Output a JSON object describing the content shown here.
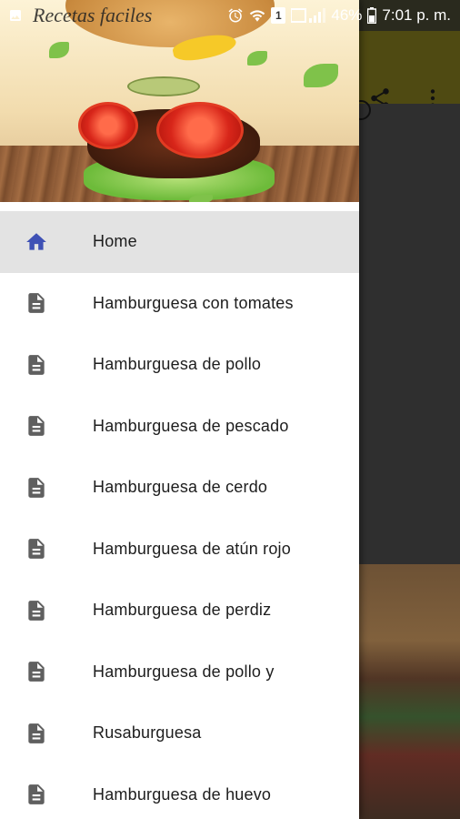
{
  "status_bar": {
    "app_title": "Recetas faciles",
    "sim_badge": "1",
    "battery_percent": "46%",
    "time": "7:01 p. m.",
    "icons": [
      "gallery-icon",
      "alarm-icon",
      "wifi-icon",
      "sim-icon",
      "signal-icon",
      "battery-icon"
    ]
  },
  "app": {
    "toolbar_color": "#4f4a12",
    "actions": [
      "share-icon",
      "overflow-menu-icon"
    ]
  },
  "drawer": {
    "header_image": "burger-photo",
    "selected_color": "#e3e3e3",
    "home_icon_color": "#3f51b5",
    "doc_icon_color": "#5f5f5f",
    "items": [
      {
        "label": "Home",
        "icon": "home-icon",
        "selected": true
      },
      {
        "label": "Hamburguesa con tomates",
        "icon": "document-icon",
        "selected": false
      },
      {
        "label": "Hamburguesa de pollo",
        "icon": "document-icon",
        "selected": false
      },
      {
        "label": "Hamburguesa de pescado",
        "icon": "document-icon",
        "selected": false
      },
      {
        "label": "Hamburguesa de cerdo",
        "icon": "document-icon",
        "selected": false
      },
      {
        "label": "Hamburguesa de atún rojo",
        "icon": "document-icon",
        "selected": false
      },
      {
        "label": "Hamburguesa de perdiz",
        "icon": "document-icon",
        "selected": false
      },
      {
        "label": "Hamburguesa de pollo y",
        "icon": "document-icon",
        "selected": false
      },
      {
        "label": "Rusaburguesa",
        "icon": "document-icon",
        "selected": false
      },
      {
        "label": "Hamburguesa de huevo",
        "icon": "document-icon",
        "selected": false
      }
    ]
  }
}
